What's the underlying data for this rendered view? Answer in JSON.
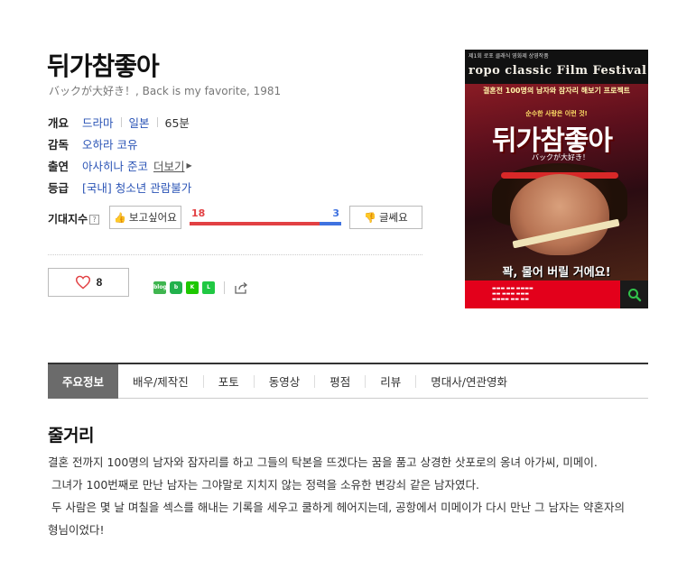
{
  "movie": {
    "title": "뒤가참좋아",
    "subtitle": "バックが大好き！, Back is my favorite, 1981"
  },
  "info": {
    "overview_label": "개요",
    "genre": "드라마",
    "country": "일본",
    "runtime": "65분",
    "director_label": "감독",
    "director": "오하라 코유",
    "cast_label": "출연",
    "cast": "아사히나 준코",
    "more_label": "더보기",
    "rating_label": "등급",
    "rating": "[국내] 청소년 관람불가"
  },
  "expectation": {
    "label": "기대지수",
    "help": "?",
    "want_label": "보고싶어요",
    "nah_label": "글쎄요",
    "want_count": "18",
    "nah_count": "3",
    "want_fraction": 0.857
  },
  "like": {
    "count": "8"
  },
  "share_icons": [
    "blog-icon",
    "band-icon",
    "kakaostory-icon",
    "line-icon",
    "share-icon"
  ],
  "poster": {
    "small_header": "제1회 로포 클래식 영화제 상영작품",
    "festival": "ropo classic Film Festival",
    "tagline_top": "결혼전 100명의 남자와 잠자리 해보기 프로젝트",
    "sub_line": "순수한 사랑은 이런 것!",
    "title": "뒤가참좋아",
    "jp_title": "バックが大好き！",
    "bottom_tag": "꽉, 물어 버릴 거에요!"
  },
  "tabs": [
    {
      "label": "주요정보",
      "active": true
    },
    {
      "label": "배우/제작진"
    },
    {
      "label": "포토"
    },
    {
      "label": "동영상"
    },
    {
      "label": "평점"
    },
    {
      "label": "리뷰"
    },
    {
      "label": "명대사/연관영화"
    }
  ],
  "synopsis": {
    "heading": "줄거리",
    "lines": [
      "결혼 전까지 100명의 남자와 잠자리를 하고 그들의 탁본을 뜨겠다는 꿈을 품고 상경한 삿포로의 옹녀 아가씨, 미메이.",
      " 그녀가 100번째로 만난 남자는 그야말로 지치지 않는 정력을 소유한 변강쇠 같은 남자였다.",
      " 두 사람은 몇 날 며칠을 섹스를 해내는 기록을 세우고 쿨하게 헤어지는데, 공항에서 미메이가 다시 만난 그 남자는 약혼자의",
      "형님이었다!"
    ]
  },
  "colors": {
    "link": "#2b54b6",
    "want": "#e24043",
    "nah": "#3f72e0",
    "active_tab": "#6b6b6b"
  }
}
